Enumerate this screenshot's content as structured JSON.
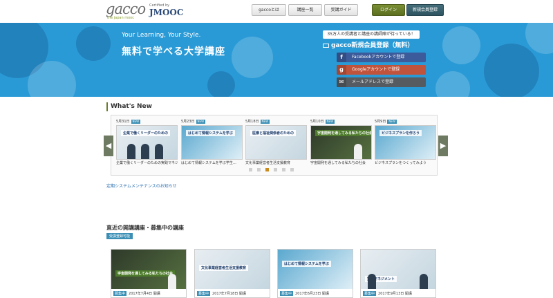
{
  "header": {
    "logo_text": "gacco",
    "logo_sub": "the japan mooc",
    "certified_label": "Certified by",
    "certified_brand": "JMOOC",
    "nav": [
      {
        "label": "gaccoとは"
      },
      {
        "label": "講座一覧"
      },
      {
        "label": "受講ガイド"
      }
    ],
    "login_label": "ログイン",
    "register_label": "新規会員登録"
  },
  "hero": {
    "tagline": "Your Learning, Your Style.",
    "title": "無料で学べる大学講座",
    "member_count": "35万人の受講者と講座の講師陣が待っている！",
    "signup_label": "gacco新規会員登録（無料）",
    "facebook_label": "Facebookアカウントで登録",
    "google_label": "Googleアカウントで登録",
    "email_label": "メールアドレスで登録",
    "colors": {
      "background": "#2a9ad6",
      "facebook": "#3b5b9a",
      "google": "#c0533c",
      "email": "#555b60"
    }
  },
  "whats_new": {
    "title": "What's New",
    "items": [
      {
        "date": "5月31日",
        "badge": "NEW",
        "thumb_label": "企業で働くリーダーのための",
        "caption": "企業で働くリーダーのための実践マネジ…"
      },
      {
        "date": "5月23日",
        "badge": "NEW",
        "thumb_label": "はじめて情報システムを学ぶ",
        "caption": "はじめて情報システムを学ぶ学生…"
      },
      {
        "date": "5月18日",
        "badge": "NEW",
        "thumb_label": "医療と福祉関係者のための",
        "caption": "文化事業経営者生活支援教育"
      },
      {
        "date": "5月10日",
        "badge": "NEW",
        "thumb_label": "宇宙開発を通してみる私たちの社会",
        "caption": "宇宙開発を通してみる私たちの社会"
      },
      {
        "date": "5月9日",
        "badge": "NEW",
        "thumb_label": "ビジネスプランを作ろう",
        "caption": "ビジネスプランをつくってみよう"
      }
    ],
    "maintenance_link": "定期システムメンテナンスのお知らせ"
  },
  "courses": {
    "title": "直近の開講講座・募集中の講座",
    "badge": "受講登録可能",
    "items": [
      {
        "badge": "募集中",
        "date": "2017年7月4日",
        "status": "開講",
        "label": "宇宙開発を通してみる私たちの社会"
      },
      {
        "badge": "募集中",
        "date": "2017年7月18日",
        "status": "開講",
        "label": "文化事業経営者生活支援教育"
      },
      {
        "badge": "募集中",
        "date": "2017年6月23日",
        "status": "開講",
        "label": "はじめて情報システムを学ぶ"
      },
      {
        "badge": "募集中",
        "date": "2017年9月13日",
        "status": "開講",
        "label": "実践マネジメント"
      }
    ]
  },
  "icons": {
    "prev_arrow": "chevron-left-icon",
    "next_arrow": "chevron-right-icon",
    "facebook": "facebook-icon",
    "google": "google-icon",
    "email": "mail-icon"
  }
}
